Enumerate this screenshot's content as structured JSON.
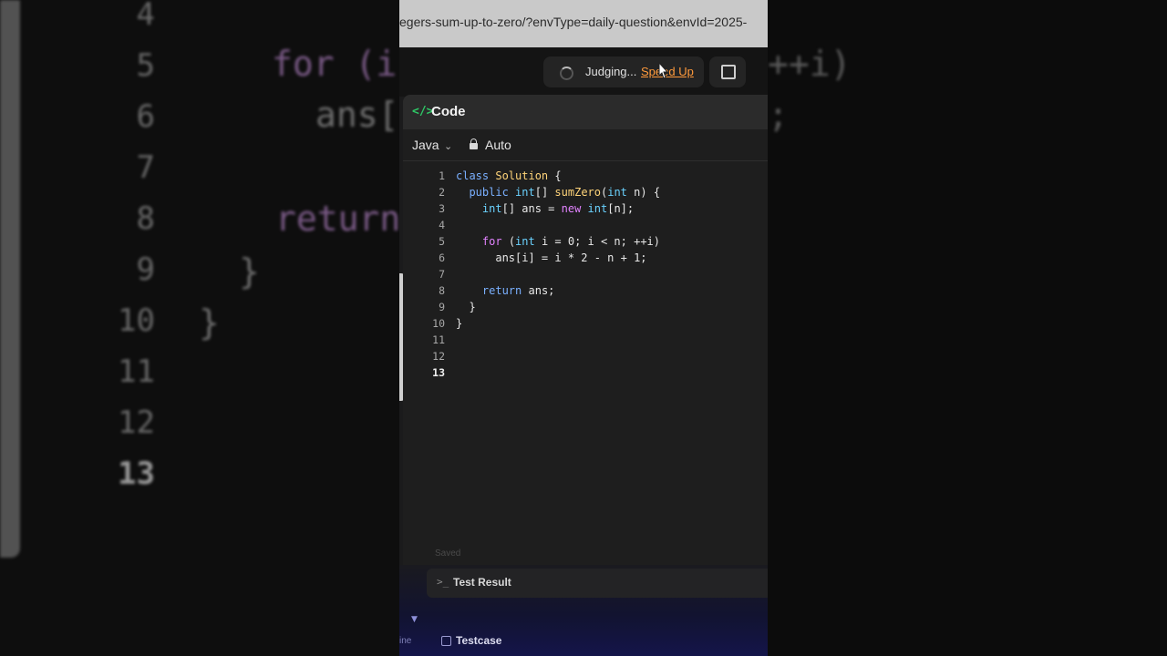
{
  "browser": {
    "url": "egers-sum-up-to-zero/?envType=daily-question&envId=2025-"
  },
  "toolbar": {
    "status_text": "Judging...",
    "speed_up_label": "Speed Up"
  },
  "panel": {
    "title": "Code",
    "language": "Java",
    "mode": "Auto",
    "saved_label": "Saved"
  },
  "editor": {
    "current_line": 13,
    "lines": [
      {
        "n": "1",
        "code": "class Solution {"
      },
      {
        "n": "2",
        "code": "  public int[] sumZero(int n) {"
      },
      {
        "n": "3",
        "code": "    int[] ans = new int[n];"
      },
      {
        "n": "4",
        "code": ""
      },
      {
        "n": "5",
        "code": "    for (int i = 0; i < n; ++i)"
      },
      {
        "n": "6",
        "code": "      ans[i] = i * 2 - n + 1;"
      },
      {
        "n": "7",
        "code": ""
      },
      {
        "n": "8",
        "code": "    return ans;"
      },
      {
        "n": "9",
        "code": "  }"
      },
      {
        "n": "10",
        "code": "}"
      },
      {
        "n": "11",
        "code": ""
      },
      {
        "n": "12",
        "code": ""
      },
      {
        "n": "13",
        "code": ""
      }
    ]
  },
  "bottom": {
    "test_result_label": "Test Result",
    "testcase_label": "Testcase",
    "left_fragment": "ine"
  },
  "background_zoom": {
    "line_numbers": [
      "4",
      "5",
      "6",
      "7",
      "8",
      "9",
      "10",
      "11",
      "12",
      "13"
    ],
    "code_fragments": [
      {
        "text": "for (i"
      },
      {
        "text": "ans["
      },
      {
        "text": "return"
      },
      {
        "text": "}"
      },
      {
        "text": "}"
      }
    ],
    "right_fragments": [
      {
        "text": "++i)"
      },
      {
        "text": ";"
      }
    ]
  },
  "colors": {
    "accent_green": "#2ec866",
    "speed_up_orange": "#ff9a3c",
    "keyword_blue": "#7ab0ff",
    "keyword_pink": "#e283ff",
    "function_yellow": "#ffd479"
  }
}
